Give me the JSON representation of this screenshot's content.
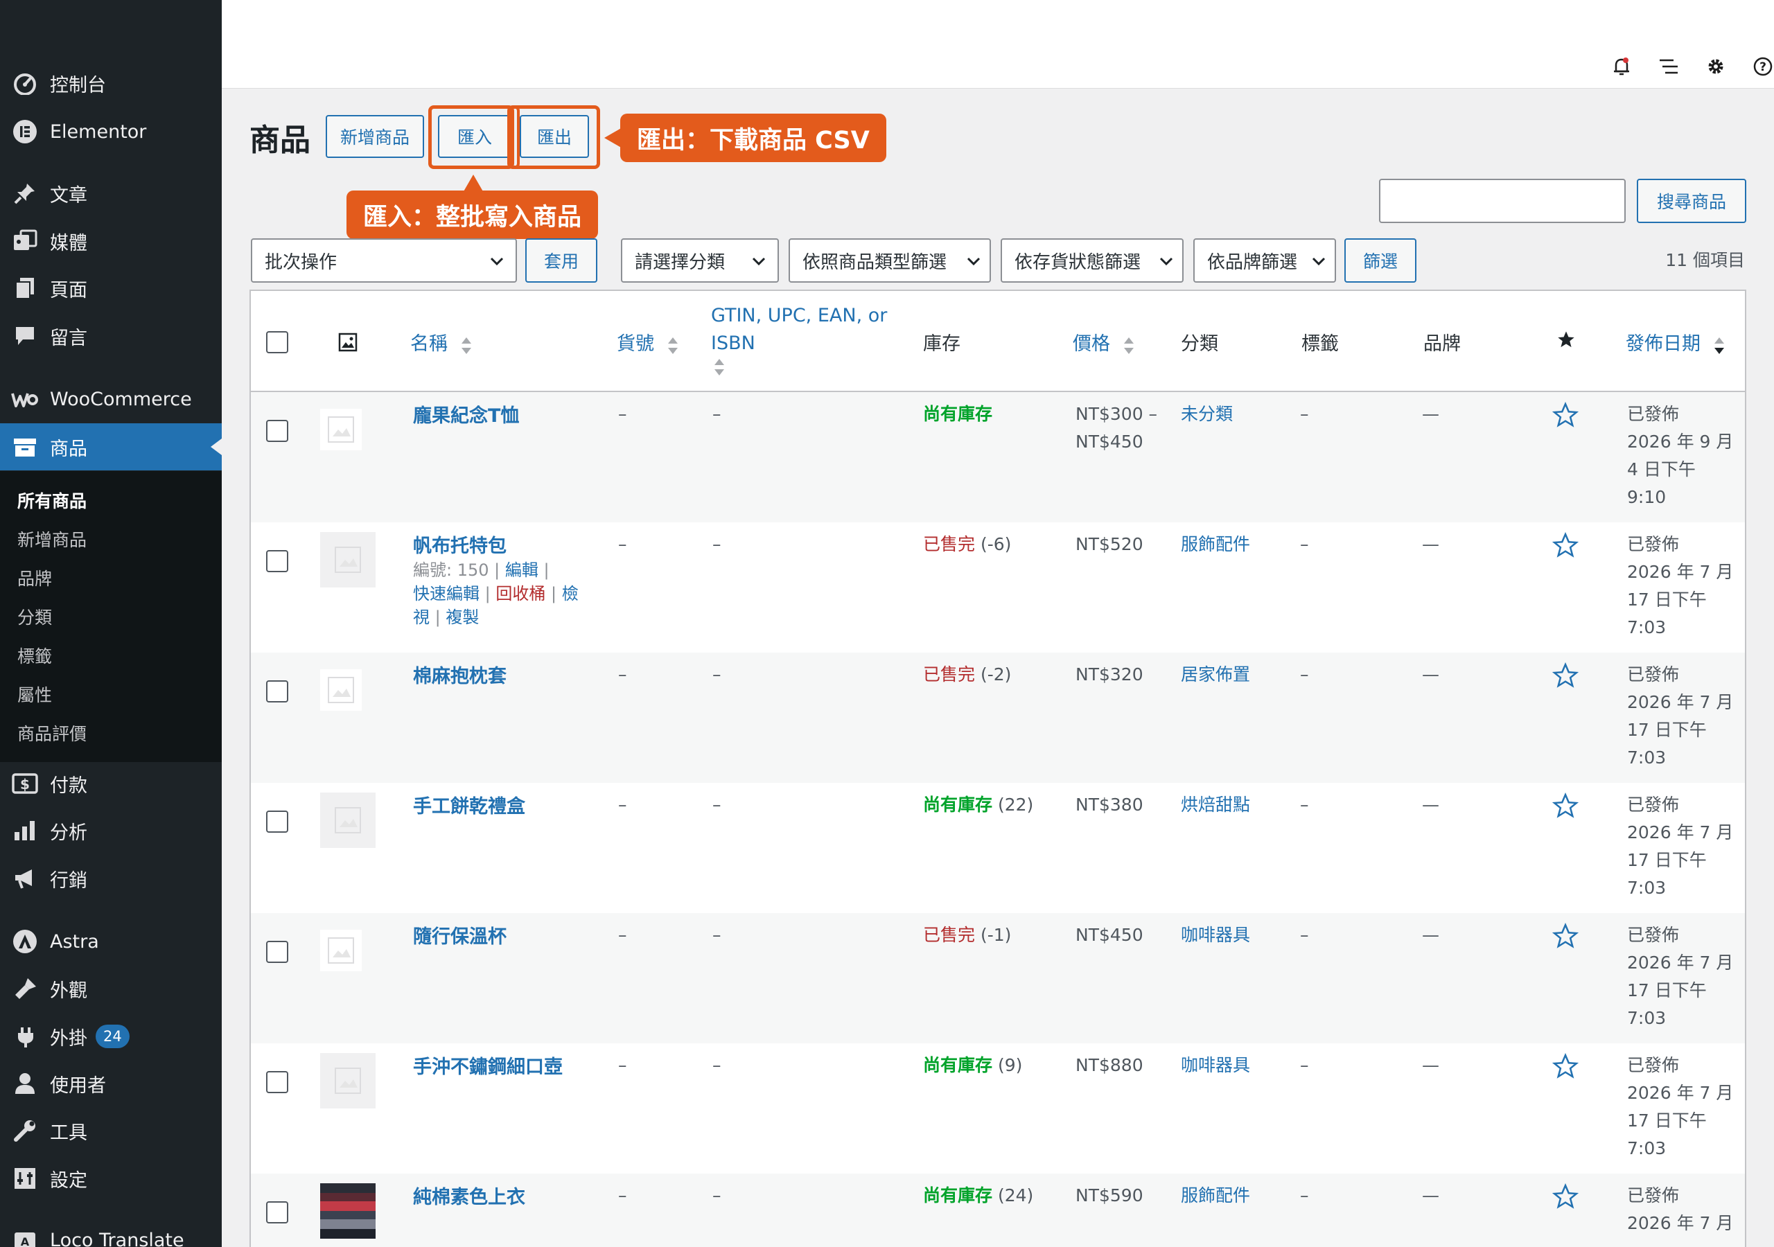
{
  "sidebar": {
    "menu": [
      {
        "label": "控制台",
        "icon": "dashboard-icon"
      },
      {
        "label": "Elementor",
        "icon": "elementor-icon"
      },
      {
        "label": "文章",
        "icon": "pin-icon"
      },
      {
        "label": "媒體",
        "icon": "media-icon"
      },
      {
        "label": "頁面",
        "icon": "pages-icon"
      },
      {
        "label": "留言",
        "icon": "comments-icon"
      },
      {
        "label": "WooCommerce",
        "icon": "woocommerce-icon"
      },
      {
        "label": "商品",
        "icon": "products-icon"
      }
    ],
    "submenu": [
      "所有商品",
      "新增商品",
      "品牌",
      "分類",
      "標籤",
      "屬性",
      "商品評價"
    ],
    "menu2": [
      {
        "label": "付款",
        "icon": "payments-icon"
      },
      {
        "label": "分析",
        "icon": "analytics-icon"
      },
      {
        "label": "行銷",
        "icon": "marketing-icon"
      },
      {
        "label": "Astra",
        "icon": "astra-icon"
      },
      {
        "label": "外觀",
        "icon": "appearance-icon"
      },
      {
        "label": "外掛",
        "icon": "plugins-icon",
        "badge": "24"
      },
      {
        "label": "使用者",
        "icon": "users-icon"
      },
      {
        "label": "工具",
        "icon": "tools-icon"
      },
      {
        "label": "設定",
        "icon": "settings-icon"
      },
      {
        "label": "Loco Translate",
        "icon": "loco-icon"
      }
    ]
  },
  "header": {
    "title": "商品",
    "add_new": "新增商品",
    "import": "匯入",
    "export": "匯出",
    "callout_export": "匯出：下載商品 CSV",
    "callout_import": "匯入：整批寫入商品"
  },
  "search": {
    "value": "",
    "button": "搜尋商品"
  },
  "filters": {
    "bulk_action": "批次操作",
    "apply": "套用",
    "category": "請選擇分類",
    "product_type": "依照商品類型篩選",
    "stock_status": "依存貨狀態篩選",
    "brand": "依品牌篩選",
    "filter_button": "篩選",
    "items_count": "11 個項目"
  },
  "columns": {
    "name": "名稱",
    "sku": "貨號",
    "gtin_line1": "GTIN, UPC, EAN, or",
    "gtin_line2": "ISBN",
    "stock": "庫存",
    "price": "價格",
    "categories": "分類",
    "tags": "標籤",
    "brands": "品牌",
    "date": "發佈日期"
  },
  "rows": [
    {
      "name": "龐果紀念T恤",
      "sku": "–",
      "gtin": "–",
      "stock_label": "尚有庫存",
      "stock_qty": "",
      "price_line1": "NT$300 –",
      "price_line2": "NT$450",
      "category": "未分類",
      "tags": "–",
      "brand": "—",
      "status": "已發佈",
      "date_line1": "2026 年 9 月",
      "date_line2": "4 日下午",
      "date_line3": "9:10"
    },
    {
      "name": "帆布托特包",
      "sku": "–",
      "gtin": "–",
      "stock_label": "已售完",
      "stock_qty": "(-6)",
      "price_line1": "NT$520",
      "price_line2": "",
      "category": "服飾配件",
      "tags": "–",
      "brand": "—",
      "status": "已發佈",
      "date_line1": "2026 年 7 月",
      "date_line2": "17 日下午",
      "date_line3": "7:03"
    },
    {
      "name": "棉麻抱枕套",
      "sku": "–",
      "gtin": "–",
      "stock_label": "已售完",
      "stock_qty": "(-2)",
      "price_line1": "NT$320",
      "price_line2": "",
      "category": "居家佈置",
      "tags": "–",
      "brand": "—",
      "status": "已發佈",
      "date_line1": "2026 年 7 月",
      "date_line2": "17 日下午",
      "date_line3": "7:03"
    },
    {
      "name": "手工餅乾禮盒",
      "sku": "–",
      "gtin": "–",
      "stock_label": "尚有庫存",
      "stock_qty": "(22)",
      "price_line1": "NT$380",
      "price_line2": "",
      "category": "烘焙甜點",
      "tags": "–",
      "brand": "—",
      "status": "已發佈",
      "date_line1": "2026 年 7 月",
      "date_line2": "17 日下午",
      "date_line3": "7:03"
    },
    {
      "name": "隨行保溫杯",
      "sku": "–",
      "gtin": "–",
      "stock_label": "已售完",
      "stock_qty": "(-1)",
      "price_line1": "NT$450",
      "price_line2": "",
      "category": "咖啡器具",
      "tags": "–",
      "brand": "—",
      "status": "已發佈",
      "date_line1": "2026 年 7 月",
      "date_line2": "17 日下午",
      "date_line3": "7:03"
    },
    {
      "name": "手沖不鏽鋼細口壺",
      "sku": "–",
      "gtin": "–",
      "stock_label": "尚有庫存",
      "stock_qty": "(9)",
      "price_line1": "NT$880",
      "price_line2": "",
      "category": "咖啡器具",
      "tags": "–",
      "brand": "—",
      "status": "已發佈",
      "date_line1": "2026 年 7 月",
      "date_line2": "17 日下午",
      "date_line3": "7:03"
    },
    {
      "name": "純棉素色上衣",
      "sku": "–",
      "gtin": "–",
      "stock_label": "尚有庫存",
      "stock_qty": "(24)",
      "price_line1": "NT$590",
      "price_line2": "",
      "category": "服飾配件",
      "tags": "–",
      "brand": "—",
      "status": "已發佈",
      "date_line1": "2026 年 7 月",
      "date_line2": "",
      "date_line3": ""
    }
  ],
  "row_actions": {
    "id_label": "編號: 150",
    "edit": "編輯",
    "quick_edit": "快速編輯",
    "trash": "回收桶",
    "view_a": "檢",
    "view_b": "視",
    "duplicate": "複製"
  },
  "colors": {
    "accent": "#2271b1",
    "callout": "#e35b1c",
    "in_stock": "#00a32a",
    "out_of_stock": "#b32d2e",
    "sidebar": "#1d2327"
  }
}
